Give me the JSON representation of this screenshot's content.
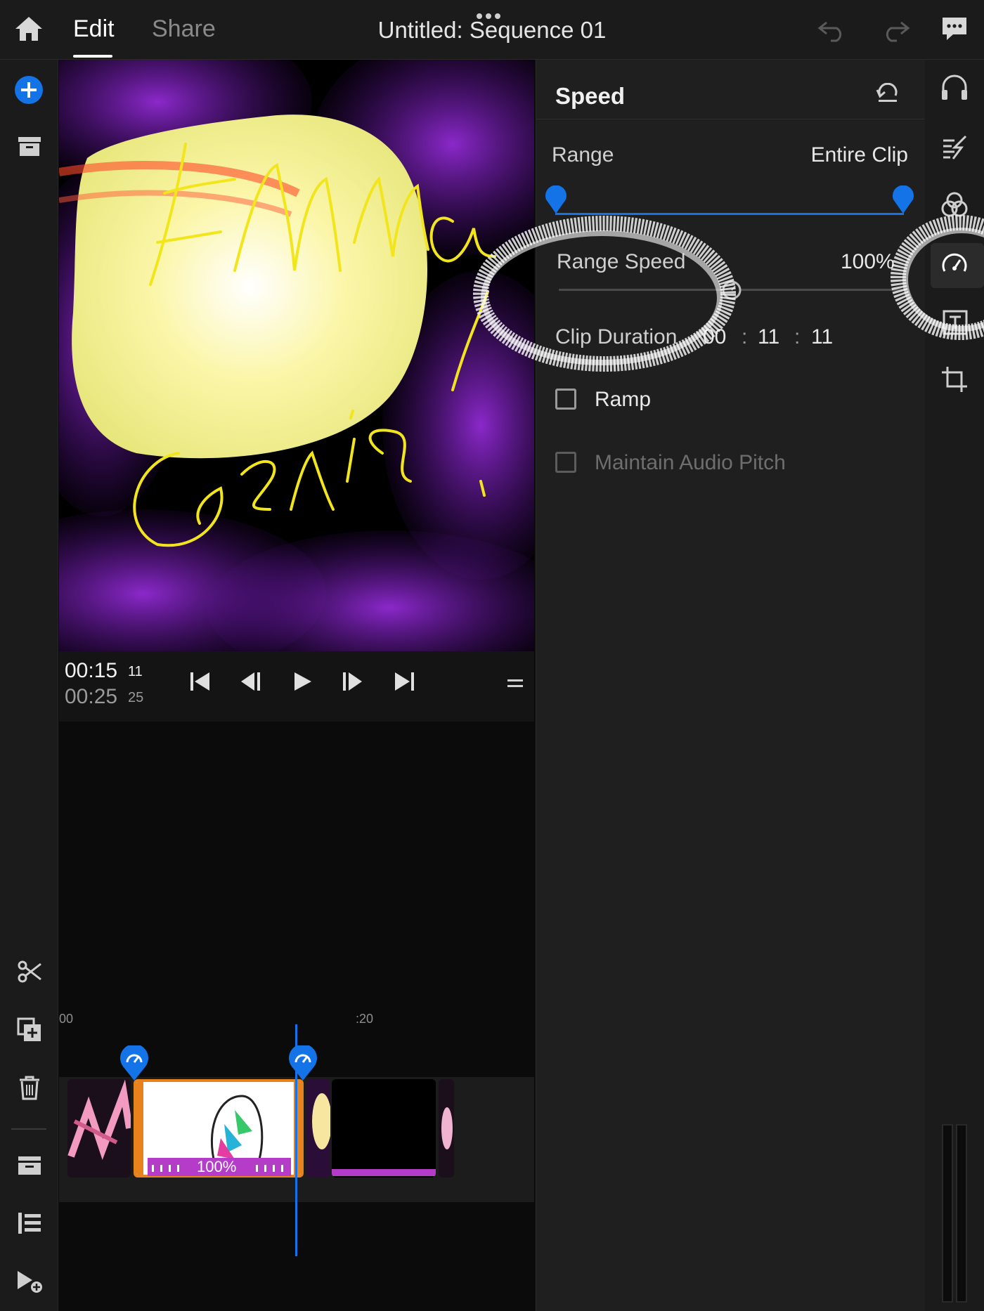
{
  "header": {
    "tabs": [
      {
        "label": "Edit",
        "active": true
      },
      {
        "label": "Share",
        "active": false
      }
    ],
    "title": "Untitled: Sequence 01"
  },
  "preview": {
    "artwork_text": [
      "Emma",
      "Genius!"
    ]
  },
  "transport": {
    "current_time": "00:15",
    "current_frames": "11",
    "total_time": "00:25",
    "total_frames": "25"
  },
  "speed_panel": {
    "title": "Speed",
    "range_label": "Range",
    "range_value": "Entire Clip",
    "range_speed_label": "Range Speed",
    "range_speed_value": "100%",
    "clip_duration_label": "Clip Duration",
    "clip_duration_parts": [
      "00",
      "11",
      "11"
    ],
    "clip_duration_sep": ":",
    "ramp_label": "Ramp",
    "ramp_checked": false,
    "maintain_pitch_label": "Maintain Audio Pitch",
    "maintain_pitch_checked": false
  },
  "timeline": {
    "ruler_marks": [
      "00",
      ":20"
    ],
    "selected_clip_speed": "100%"
  },
  "icons": {
    "left_toolbar": [
      "home-icon",
      "add-media-icon",
      "archive-icon",
      "scissors-icon",
      "duplicate-icon",
      "trash-icon",
      "track-icon",
      "list-icon",
      "add-track-icon"
    ],
    "right_toolbar": [
      "audio-icon",
      "transitions-icon",
      "color-icon",
      "speed-icon",
      "crop-icon"
    ]
  },
  "colors": {
    "accent": "#1473e6",
    "clip_selected": "#e8821c",
    "speed_bar": "#b43cc8",
    "panel_bg": "#1f1f1f"
  }
}
